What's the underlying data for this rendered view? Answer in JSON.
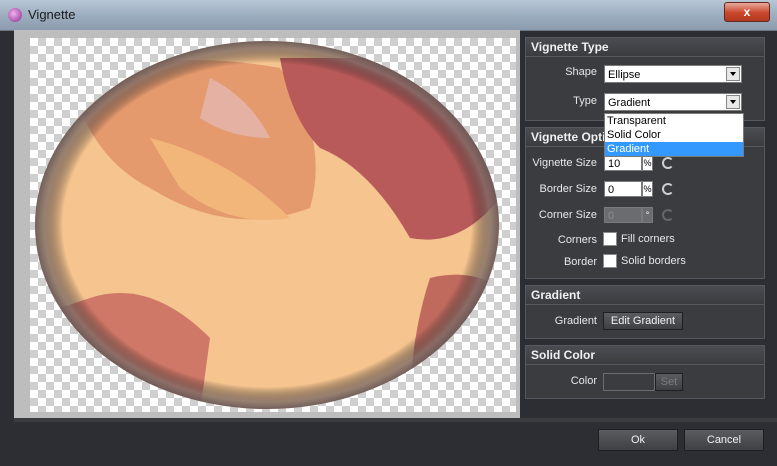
{
  "window": {
    "title": "Vignette",
    "close_label": "x"
  },
  "vignette_type": {
    "header": "Vignette Type",
    "shape_label": "Shape",
    "shape_value": "Ellipse",
    "type_label": "Type",
    "type_value": "Gradient",
    "type_options": [
      "Transparent",
      "Solid Color",
      "Gradient"
    ]
  },
  "vignette_options": {
    "header": "Vignette Opti",
    "size_label": "Vignette Size",
    "size_value": "10",
    "size_unit": "%",
    "border_label": "Border Size",
    "border_value": "0",
    "border_unit": "%",
    "corner_label": "Corner Size",
    "corner_value": "0",
    "corner_unit": "°",
    "corners_label": "Corners",
    "corners_checkbox_label": "Fill corners",
    "border_row_label": "Border",
    "border_checkbox_label": "Solid borders"
  },
  "gradient": {
    "header": "Gradient",
    "label": "Gradient",
    "button": "Edit Gradient"
  },
  "solid_color": {
    "header": "Solid Color",
    "label": "Color",
    "set_button": "Set"
  },
  "footer": {
    "ok": "Ok",
    "cancel": "Cancel"
  }
}
